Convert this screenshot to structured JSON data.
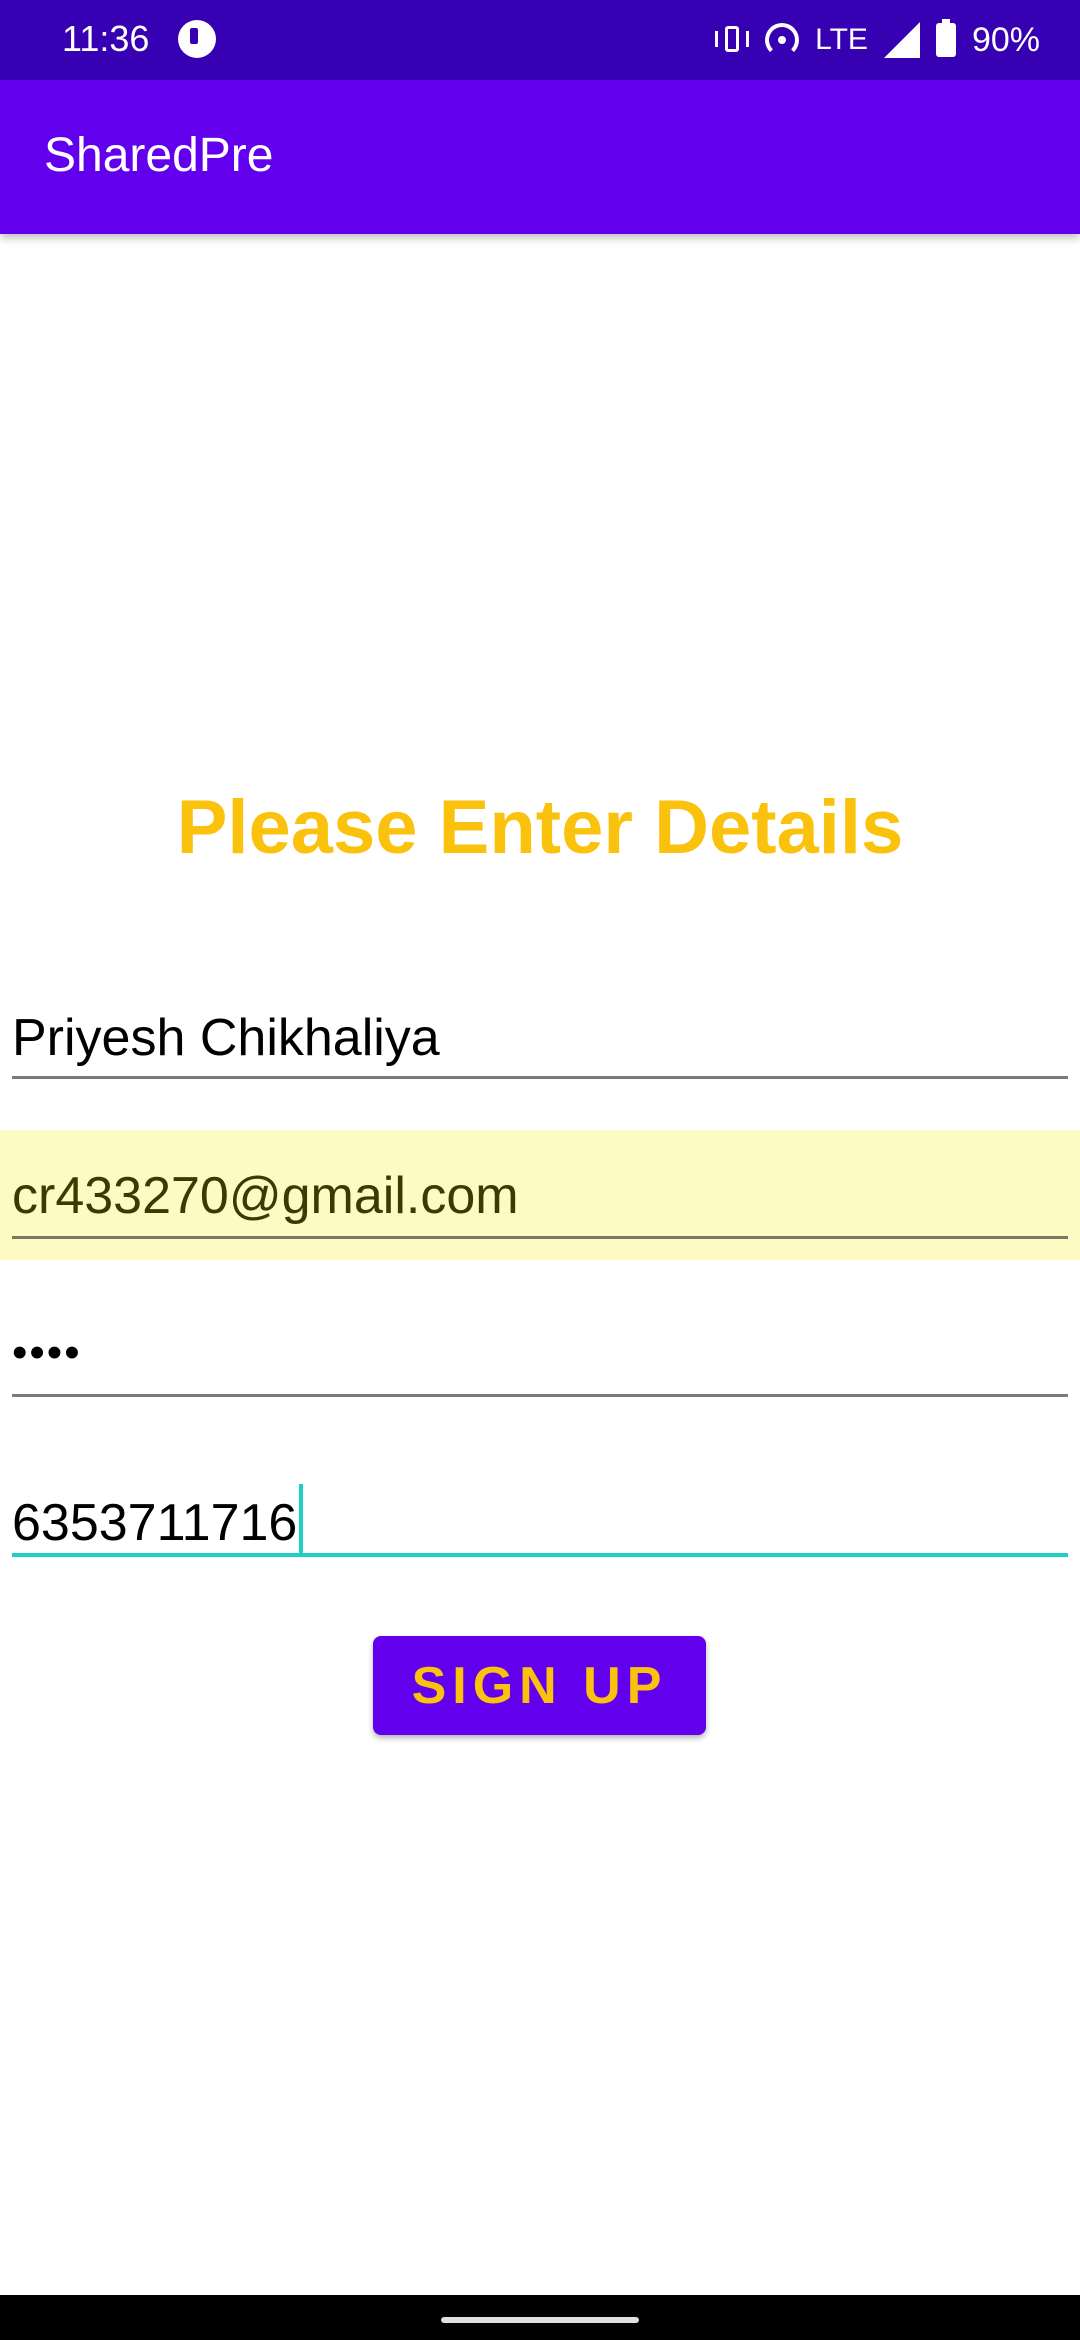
{
  "status_bar": {
    "time": "11:36",
    "network": "LTE",
    "battery": "90%",
    "icons": [
      "app-notification-icon",
      "vibrate-icon",
      "hotspot-icon",
      "signal-icon",
      "battery-icon"
    ]
  },
  "app_bar": {
    "title": "SharedPre",
    "color": "#6200ee"
  },
  "form": {
    "heading": "Please Enter Details",
    "name_value": "Priyesh Chikhaliya",
    "email_value": "cr433270@gmail.com",
    "password_value": "••••",
    "phone_value": "6353711716",
    "signup_label": "SIGN UP",
    "accent_color": "#fbc20d",
    "focus_color": "#1ecfc6"
  }
}
